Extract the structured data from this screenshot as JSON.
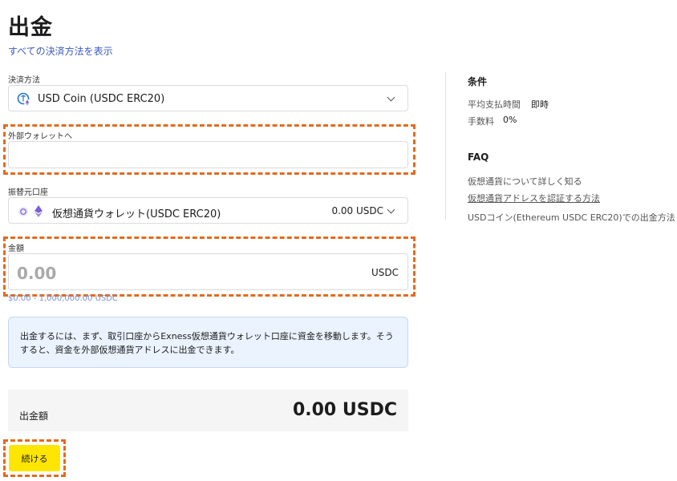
{
  "page": {
    "title": "出金",
    "all_methods_link": "すべての決済方法を表示"
  },
  "form": {
    "payment_method_label": "決済方法",
    "payment_method_value": "USD Coin (USDC ERC20)",
    "wallet_label": "外部ウォレットへ",
    "wallet_value": "",
    "source_label": "振替元口座",
    "source_value": "仮想通貨ウォレット(USDC ERC20)",
    "source_balance": "0.00 USDC",
    "amount_label": "金額",
    "amount_placeholder": "0.00",
    "amount_currency": "USDC",
    "amount_range": "$0.00 - 1,000,000.00 USDC"
  },
  "info": {
    "text": "出金するには、まず、取引口座からExness仮想通貨ウォレット口座に資金を移動します。そうすると、資金を外部仮想通貨アドレスに出金できます。"
  },
  "summary": {
    "label": "出金額",
    "amount": "0.00 USDC"
  },
  "continue_button": "続ける",
  "sidebar": {
    "conditions_heading": "条件",
    "avg_time_label": "平均支払時間",
    "avg_time_value": "即時",
    "fee_label": "手数料",
    "fee_value": "0%",
    "faq_heading": "FAQ",
    "faq_links": [
      "仮想通貨について詳しく知る",
      "仮想通貨アドレスを認証する方法",
      "USDコイン(Ethereum USDC ERC20)での出金方法"
    ]
  },
  "colors": {
    "accent_yellow": "#ffe600",
    "highlight_orange": "#e46a1d",
    "link_blue": "#3b5bc0",
    "info_bg": "#eaf3ff"
  }
}
